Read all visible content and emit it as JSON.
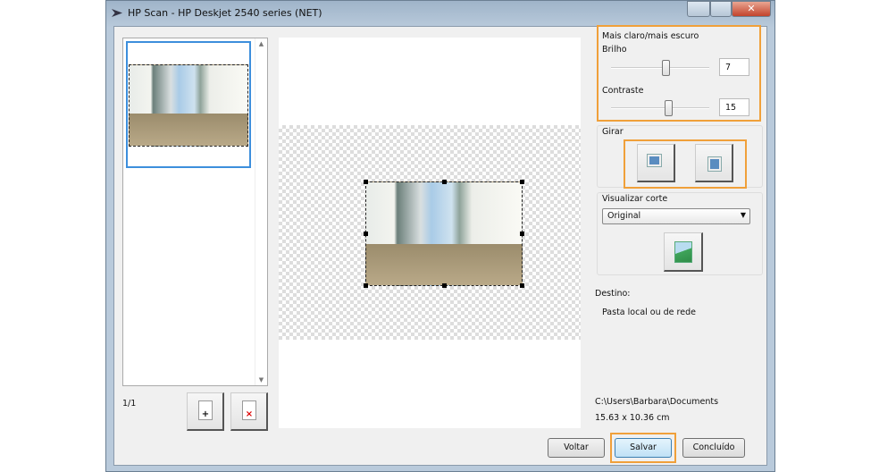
{
  "window": {
    "title": "HP Scan - HP Deskjet 2540 series (NET)"
  },
  "adjust": {
    "group_label": "Mais claro/mais escuro",
    "brightness_label": "Brilho",
    "brightness_value": "7",
    "brightness_fraction": 0.55,
    "contrast_label": "Contraste",
    "contrast_value": "15",
    "contrast_fraction": 0.58
  },
  "rotate": {
    "group_label": "Girar"
  },
  "crop": {
    "group_label": "Visualizar corte",
    "selected": "Original"
  },
  "destination": {
    "label": "Destino:",
    "value": "Pasta local ou de rede",
    "path": "C:\\Users\\Barbara\\Documents",
    "size": "15.63 x 10.36 cm"
  },
  "pages": {
    "counter": "1/1"
  },
  "buttons": {
    "back": "Voltar",
    "save": "Salvar",
    "done": "Concluído"
  },
  "colors": {
    "highlight": "#f0a03a",
    "selection": "#3d8fdc"
  }
}
